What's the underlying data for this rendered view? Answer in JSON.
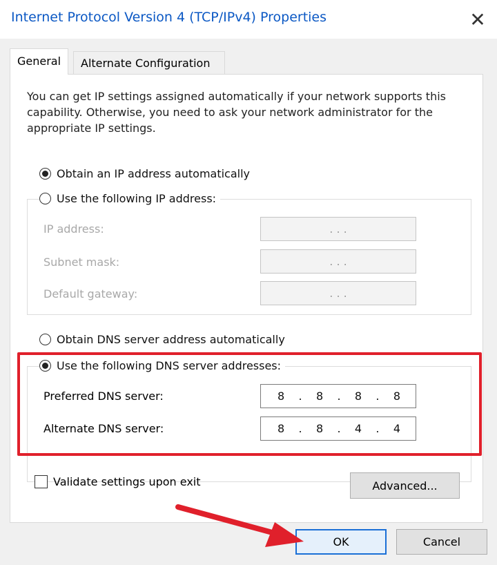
{
  "window": {
    "title": "Internet Protocol Version 4 (TCP/IPv4) Properties",
    "close_glyph": "✕"
  },
  "tabs": [
    {
      "label": "General",
      "active": true
    },
    {
      "label": "Alternate Configuration",
      "active": false
    }
  ],
  "intro_text": "You can get IP settings assigned automatically if your network supports this capability. Otherwise, you need to ask your network administrator for the appropriate IP settings.",
  "ip_section": {
    "auto_label": "Obtain an IP address automatically",
    "manual_label": "Use the following IP address:",
    "fields": [
      {
        "label": "IP address:",
        "value": ". . ."
      },
      {
        "label": "Subnet mask:",
        "value": ". . ."
      },
      {
        "label": "Default gateway:",
        "value": ". . ."
      }
    ]
  },
  "dns_section": {
    "auto_label": "Obtain DNS server address automatically",
    "manual_label": "Use the following DNS server addresses:",
    "preferred": {
      "label": "Preferred DNS server:",
      "octets": [
        "8",
        "8",
        "8",
        "8"
      ]
    },
    "alternate": {
      "label": "Alternate DNS server:",
      "octets": [
        "8",
        "8",
        "4",
        "4"
      ]
    }
  },
  "validate_label": "Validate settings upon exit",
  "buttons": {
    "advanced": "Advanced...",
    "ok": "OK",
    "cancel": "Cancel"
  },
  "colors": {
    "title_blue": "#0b58c4",
    "highlight_red": "#e0202b",
    "ok_border": "#1a6fd6"
  }
}
